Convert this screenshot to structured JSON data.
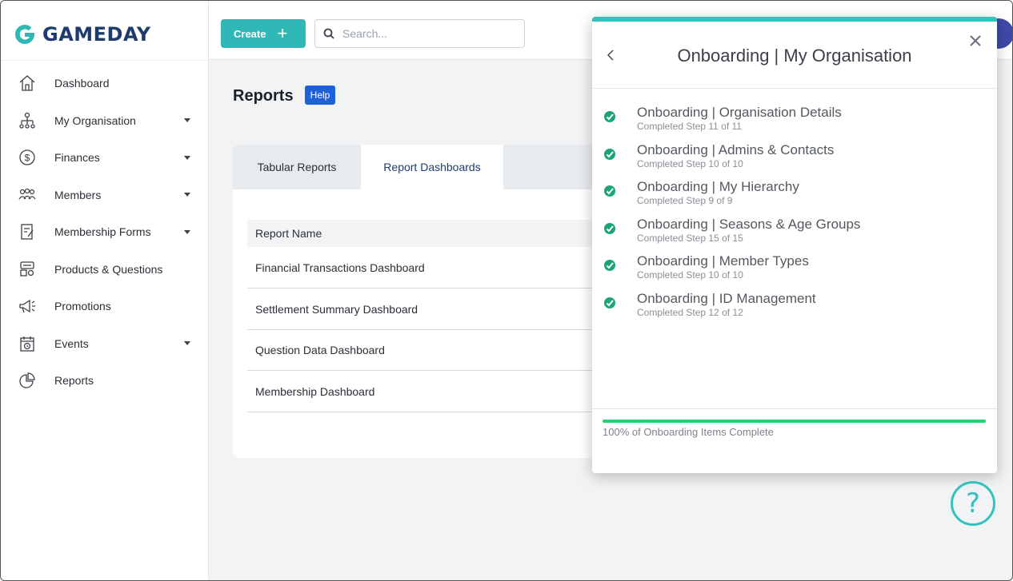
{
  "brand": {
    "logo_text": "GAMEDAY",
    "accent": "#2fb8b5",
    "navy": "#1e3a6e"
  },
  "topbar": {
    "create_label": "Create",
    "search_placeholder": "Search..."
  },
  "sidebar": {
    "items": [
      {
        "label": "Dashboard",
        "icon": "home-icon",
        "has_caret": false
      },
      {
        "label": "My Organisation",
        "icon": "org-chart-icon",
        "has_caret": true
      },
      {
        "label": "Finances",
        "icon": "dollar-icon",
        "has_caret": true
      },
      {
        "label": "Members",
        "icon": "members-icon",
        "has_caret": true
      },
      {
        "label": "Membership Forms",
        "icon": "form-icon",
        "has_caret": true
      },
      {
        "label": "Products & Questions",
        "icon": "products-icon",
        "has_caret": false
      },
      {
        "label": "Promotions",
        "icon": "megaphone-icon",
        "has_caret": false
      },
      {
        "label": "Events",
        "icon": "calendar-icon",
        "has_caret": true
      },
      {
        "label": "Reports",
        "icon": "pie-chart-icon",
        "has_caret": false
      }
    ]
  },
  "main": {
    "title": "Reports",
    "help_label": "Help",
    "tabs": [
      {
        "label": "Tabular Reports",
        "active": false
      },
      {
        "label": "Report Dashboards",
        "active": true
      }
    ],
    "table_header": "Report Name",
    "rows": [
      "Financial Transactions Dashboard",
      "Settlement Summary Dashboard",
      "Question Data Dashboard",
      "Membership Dashboard"
    ]
  },
  "modal": {
    "title": "Onboarding | My Organisation",
    "steps": [
      {
        "title": "Onboarding | Organisation Details",
        "sub": "Completed Step 11 of 11"
      },
      {
        "title": "Onboarding | Admins & Contacts",
        "sub": "Completed Step 10 of 10"
      },
      {
        "title": "Onboarding | My Hierarchy",
        "sub": "Completed Step 9 of 9"
      },
      {
        "title": "Onboarding | Seasons & Age Groups",
        "sub": "Completed Step 15 of 15"
      },
      {
        "title": "Onboarding | Member Types",
        "sub": "Completed Step 10 of 10"
      },
      {
        "title": "Onboarding | ID Management",
        "sub": "Completed Step 12 of 12"
      }
    ],
    "progress_fraction": 1.0,
    "progress_text": "100% of Onboarding Items Complete"
  }
}
